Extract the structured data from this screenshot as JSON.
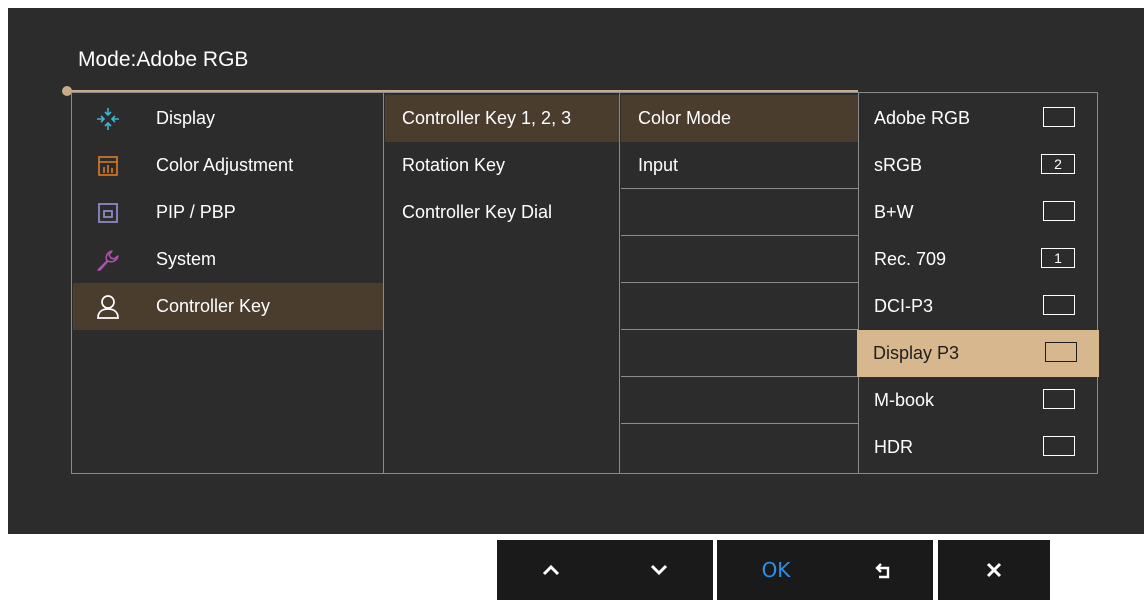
{
  "header": {
    "mode_label": "Mode:",
    "mode_value": "Adobe RGB"
  },
  "menu": [
    {
      "label": "Display",
      "icon": "display-icon",
      "color": "#3bb6d6"
    },
    {
      "label": "Color Adjustment",
      "icon": "color-adjustment-icon",
      "color": "#e07b22"
    },
    {
      "label": "PIP / PBP",
      "icon": "pip-pbp-icon",
      "color": "#8f88c6"
    },
    {
      "label": "System",
      "icon": "system-wrench-icon",
      "color": "#b34fb3"
    },
    {
      "label": "Controller Key",
      "icon": "controller-key-user-icon",
      "color": "#ffffff",
      "selected": true
    }
  ],
  "submenu": [
    {
      "label": "Controller Key 1, 2, 3",
      "selected": true
    },
    {
      "label": "Rotation Key"
    },
    {
      "label": "Controller Key Dial"
    }
  ],
  "functions": [
    {
      "label": "Color Mode",
      "selected": true
    },
    {
      "label": "Input"
    },
    {
      "label": ""
    },
    {
      "label": ""
    },
    {
      "label": ""
    },
    {
      "label": ""
    },
    {
      "label": ""
    },
    {
      "label": ""
    }
  ],
  "options": [
    {
      "label": "Adobe RGB",
      "slot": ""
    },
    {
      "label": "sRGB",
      "slot": "2"
    },
    {
      "label": "B+W",
      "slot": ""
    },
    {
      "label": "Rec. 709",
      "slot": "1"
    },
    {
      "label": "DCI-P3",
      "slot": ""
    },
    {
      "label": "Display P3",
      "slot": "",
      "highlighted": true
    },
    {
      "label": "M-book",
      "slot": ""
    },
    {
      "label": "HDR",
      "slot": ""
    }
  ],
  "buttons": {
    "up": "up-arrow-icon",
    "down": "down-arrow-icon",
    "ok": "OK",
    "back": "return-icon",
    "close": "close-icon"
  }
}
